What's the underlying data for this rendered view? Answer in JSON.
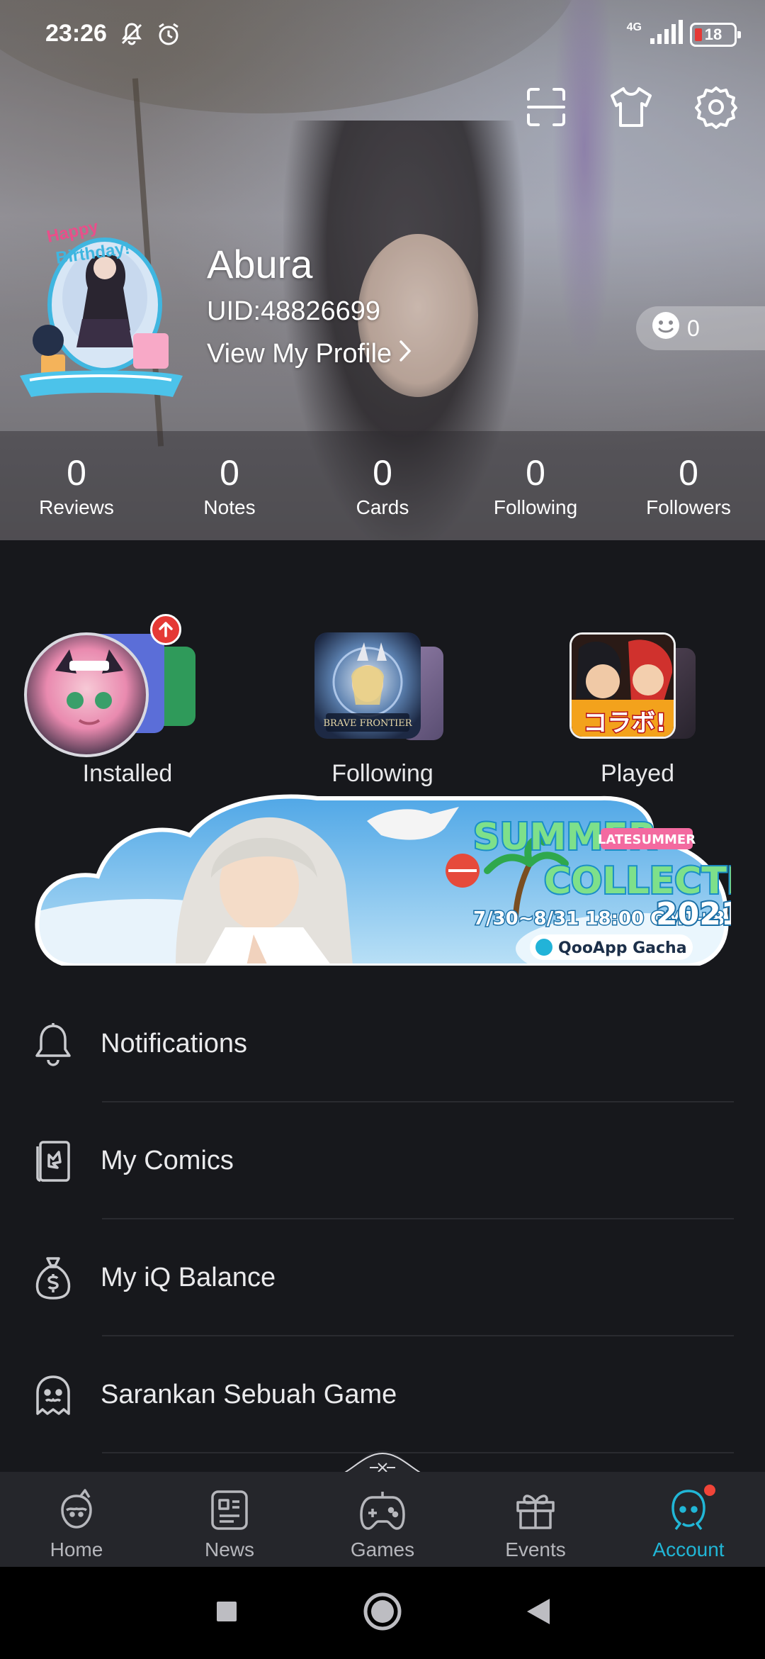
{
  "status_bar": {
    "time": "23:26",
    "network": "4G",
    "battery": "18"
  },
  "header": {
    "icons": [
      "scan-icon",
      "tshirt-icon",
      "gear-icon"
    ],
    "avatar_icon": "birthday-avatar-badge"
  },
  "profile": {
    "name": "Abura",
    "uid": "UID:48826699",
    "view_profile": "View My Profile",
    "mood_count": "0"
  },
  "stats": [
    {
      "value": "0",
      "label": "Reviews"
    },
    {
      "value": "0",
      "label": "Notes"
    },
    {
      "value": "0",
      "label": "Cards"
    },
    {
      "value": "0",
      "label": "Following"
    },
    {
      "value": "0",
      "label": "Followers"
    }
  ],
  "shortcuts": [
    {
      "label": "Installed"
    },
    {
      "label": "Following"
    },
    {
      "label": "Played"
    }
  ],
  "menu": [
    {
      "label": "Notifications",
      "icon": "bell-icon"
    },
    {
      "label": "My Comics",
      "icon": "comic-book-icon"
    },
    {
      "label": "My iQ Balance",
      "icon": "money-bag-icon"
    },
    {
      "label": "Sarankan Sebuah Game",
      "icon": "ghost-icon"
    }
  ],
  "bottom_nav": [
    {
      "label": "Home",
      "icon": "home-mascot-icon"
    },
    {
      "label": "News",
      "icon": "news-icon"
    },
    {
      "label": "Games",
      "icon": "gamepad-icon"
    },
    {
      "label": "Events",
      "icon": "gift-icon"
    },
    {
      "label": "Account",
      "icon": "account-icon",
      "active": true
    }
  ],
  "colors": {
    "accent": "#21b6d6",
    "background": "#17181c",
    "nav_bg": "#25262b",
    "badge": "#e53935"
  }
}
